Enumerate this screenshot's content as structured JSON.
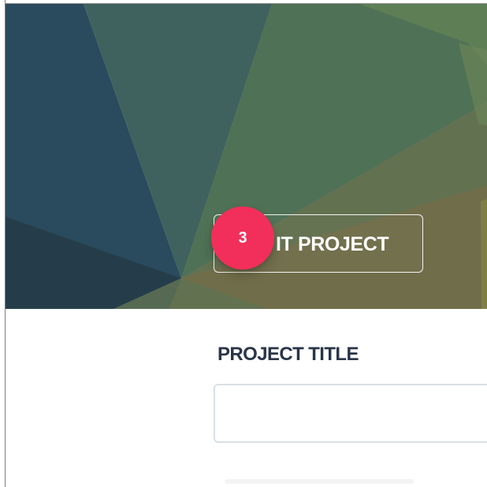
{
  "hero": {
    "project_button_label": "IT PROJECT"
  },
  "step_badge": {
    "number": "3"
  },
  "project_form": {
    "title_label": "PROJECT TITLE",
    "title_value": ""
  },
  "icons": {},
  "colors": {
    "badge": "#f22f5a",
    "heading_text": "#293548",
    "input_border": "#d8dfe6",
    "hero_dark_blue": "#294656",
    "hero_green": "#557653",
    "hero_olive": "#716f4b"
  }
}
